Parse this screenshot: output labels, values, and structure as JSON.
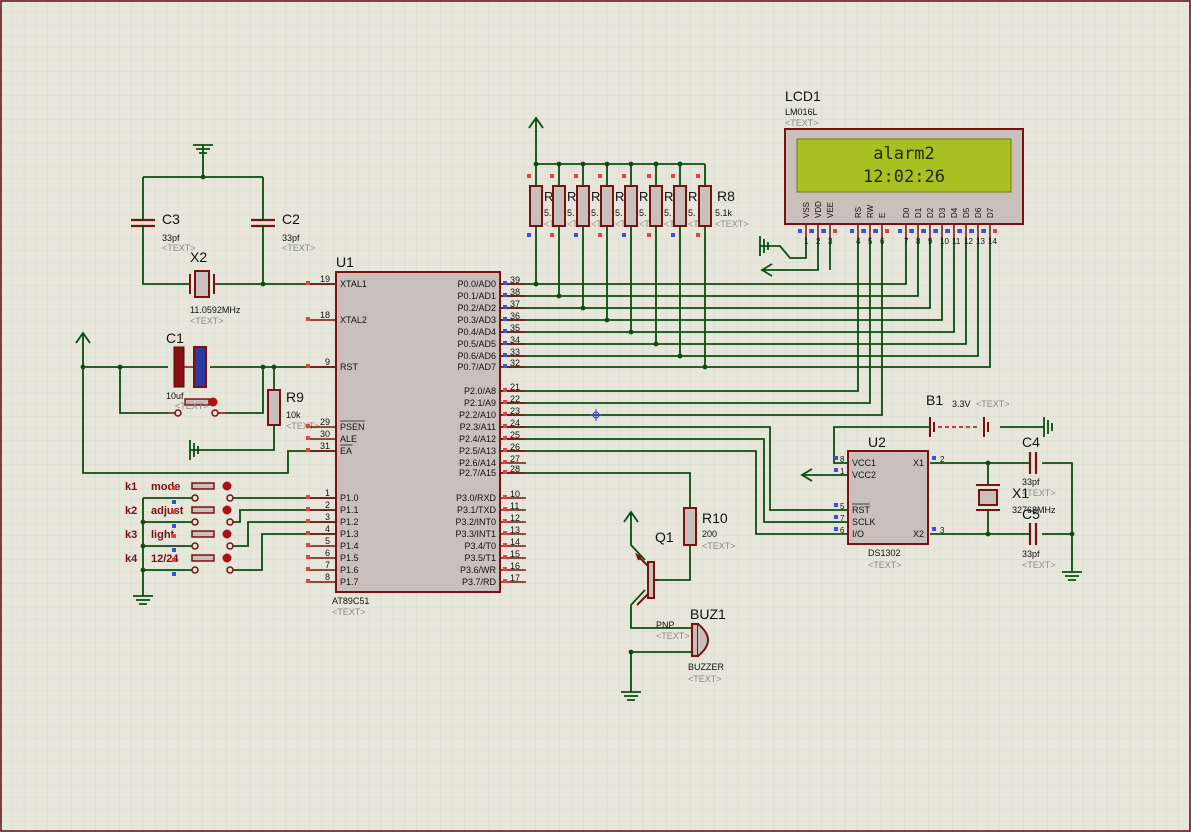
{
  "colors": {
    "background": "#e6e6da",
    "grid": "#cfcfc0",
    "wire": "#0b4d12",
    "component_outline": "#7a1010",
    "component_fill": "#c9c0bc",
    "pin_red": "#e84040",
    "pin_blue": "#3a50e0",
    "lcd_screen": "#a8c020",
    "lcd_text": "#1f2a08",
    "placeholder_text": "#8a8a8a"
  },
  "lcd1": {
    "ref": "LCD1",
    "model": "LM016L",
    "text_placeholder": "<TEXT>",
    "line1": "alarm2",
    "line2": "12:02:26",
    "pin_names": [
      "VSS",
      "VDD",
      "VEE",
      "RS",
      "RW",
      "E",
      "D0",
      "D1",
      "D2",
      "D3",
      "D4",
      "D5",
      "D6",
      "D7"
    ],
    "pin_numbers": [
      "1",
      "2",
      "3",
      "4",
      "5",
      "6",
      "7",
      "8",
      "9",
      "10",
      "11",
      "12",
      "13",
      "14"
    ]
  },
  "u1": {
    "ref": "U1",
    "model": "AT89C51",
    "text_placeholder": "<TEXT>",
    "left_pins": [
      {
        "num": "19",
        "name": "XTAL1"
      },
      {
        "num": "18",
        "name": "XTAL2"
      },
      {
        "num": "9",
        "name": "RST"
      },
      {
        "num": "29",
        "name": "PSEN"
      },
      {
        "num": "30",
        "name": "ALE"
      },
      {
        "num": "31",
        "name": "EA"
      },
      {
        "num": "1",
        "name": "P1.0"
      },
      {
        "num": "2",
        "name": "P1.1"
      },
      {
        "num": "3",
        "name": "P1.2"
      },
      {
        "num": "4",
        "name": "P1.3"
      },
      {
        "num": "5",
        "name": "P1.4"
      },
      {
        "num": "6",
        "name": "P1.5"
      },
      {
        "num": "7",
        "name": "P1.6"
      },
      {
        "num": "8",
        "name": "P1.7"
      }
    ],
    "right_pins": [
      {
        "num": "39",
        "name": "P0.0/AD0"
      },
      {
        "num": "38",
        "name": "P0.1/AD1"
      },
      {
        "num": "37",
        "name": "P0.2/AD2"
      },
      {
        "num": "36",
        "name": "P0.3/AD3"
      },
      {
        "num": "35",
        "name": "P0.4/AD4"
      },
      {
        "num": "34",
        "name": "P0.5/AD5"
      },
      {
        "num": "33",
        "name": "P0.6/AD6"
      },
      {
        "num": "32",
        "name": "P0.7/AD7"
      },
      {
        "num": "21",
        "name": "P2.0/A8"
      },
      {
        "num": "22",
        "name": "P2.1/A9"
      },
      {
        "num": "23",
        "name": "P2.2/A10"
      },
      {
        "num": "24",
        "name": "P2.3/A11"
      },
      {
        "num": "25",
        "name": "P2.4/A12"
      },
      {
        "num": "26",
        "name": "P2.5/A13"
      },
      {
        "num": "27",
        "name": "P2.6/A14"
      },
      {
        "num": "28",
        "name": "P2.7/A15"
      },
      {
        "num": "10",
        "name": "P3.0/RXD"
      },
      {
        "num": "11",
        "name": "P3.1/TXD"
      },
      {
        "num": "12",
        "name": "P3.2/INT0"
      },
      {
        "num": "13",
        "name": "P3.3/INT1"
      },
      {
        "num": "14",
        "name": "P3.4/T0"
      },
      {
        "num": "15",
        "name": "P3.5/T1"
      },
      {
        "num": "16",
        "name": "P3.6/WR"
      },
      {
        "num": "17",
        "name": "P3.7/RD"
      }
    ]
  },
  "u2": {
    "ref": "U2",
    "model": "DS1302",
    "text_placeholder": "<TEXT>",
    "pins": [
      {
        "num": "8",
        "name": "VCC1"
      },
      {
        "num": "1",
        "name": "VCC2"
      },
      {
        "num": "5",
        "name": "RST"
      },
      {
        "num": "7",
        "name": "SCLK"
      },
      {
        "num": "6",
        "name": "I/O"
      },
      {
        "num": "2",
        "name": "X1"
      },
      {
        "num": "3",
        "name": "X2"
      }
    ]
  },
  "components": {
    "c3": {
      "ref": "C3",
      "value": "33pf",
      "text": "<TEXT>"
    },
    "c2": {
      "ref": "C2",
      "value": "33pf",
      "text": "<TEXT>"
    },
    "x2": {
      "ref": "X2",
      "value": "11.0592MHz",
      "text": "<TEXT>"
    },
    "c1": {
      "ref": "C1",
      "value": "10uf",
      "text": "<TEXT>"
    },
    "r9": {
      "ref": "R9",
      "value": "10k",
      "text": "<TEXT>"
    },
    "r8": {
      "ref": "R8",
      "value": "5.1k",
      "text": "<TEXT>"
    },
    "rpack_labels": [
      "R",
      "R",
      "R",
      "R",
      "R",
      "R",
      "R"
    ],
    "rpack_values": [
      "5.",
      "5.",
      "5.",
      "5.",
      "5.",
      "5.",
      "5."
    ],
    "rpack_text_frag": [
      "<TE",
      "<TE",
      "<TE",
      "<TE",
      "<TE",
      "<TE",
      "<TE"
    ],
    "r10": {
      "ref": "R10",
      "value": "200",
      "text": "<TEXT>"
    },
    "q1": {
      "ref": "Q1",
      "type": "PNP",
      "text": "<TEXT>"
    },
    "buz1": {
      "ref": "BUZ1",
      "type": "BUZZER",
      "text": "<TEXT>"
    },
    "b1": {
      "ref": "B1",
      "value": "3.3V",
      "text": "<TEXT>"
    },
    "c4": {
      "ref": "C4",
      "value": "33pf",
      "text": "<TEXT>"
    },
    "x1": {
      "ref": "X1",
      "value": "32768MHz",
      "text": "<TEXT>"
    },
    "c5": {
      "ref": "C5",
      "value": "33pf",
      "text": "<TEXT>"
    }
  },
  "keys": [
    {
      "ref": "k1",
      "label": "mode"
    },
    {
      "ref": "k2",
      "label": "adjust"
    },
    {
      "ref": "k3",
      "label": "light"
    },
    {
      "ref": "k4",
      "label": "12/24"
    }
  ]
}
